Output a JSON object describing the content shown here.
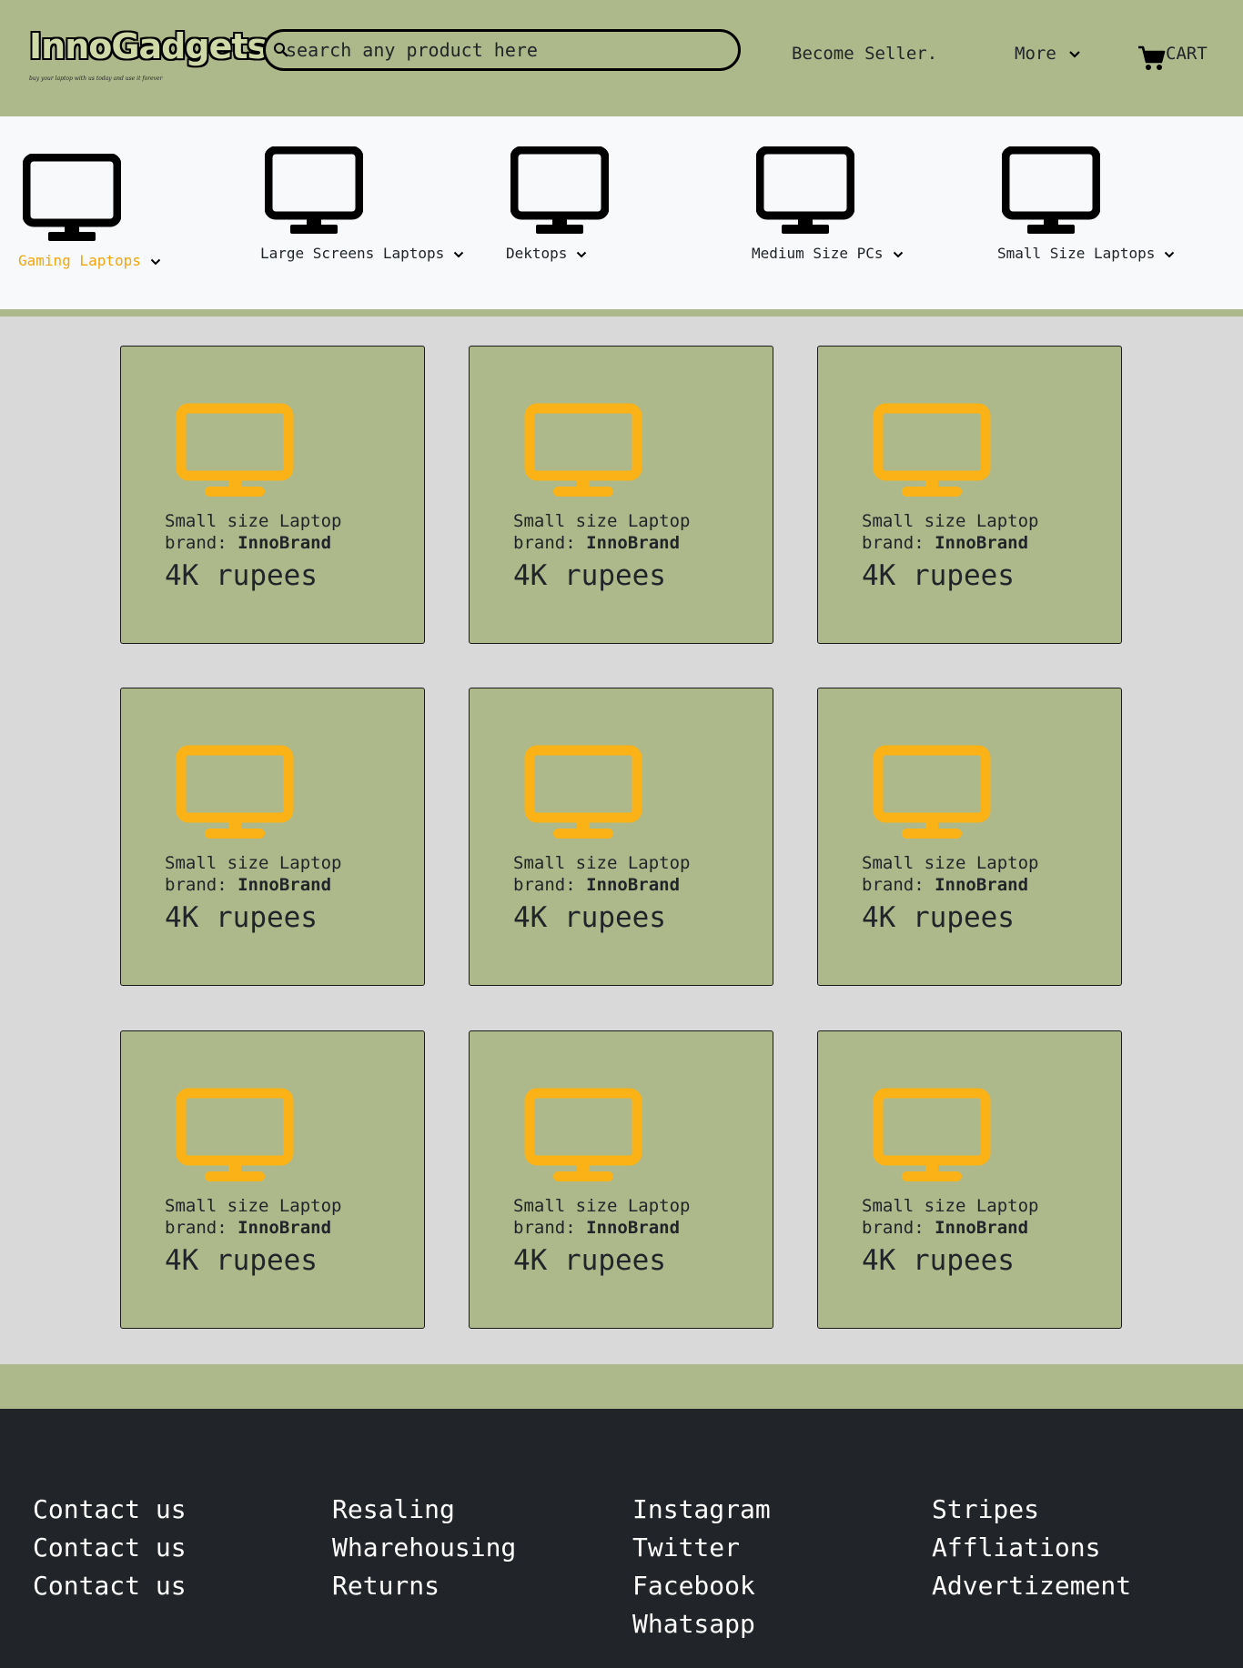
{
  "header": {
    "logo_text": "InnoGadgets",
    "logo_tagline": "buy your laptop with us today and use it forever",
    "search_placeholder": "search any product here",
    "become_seller": "Become Seller.",
    "more": "More",
    "cart": "CART"
  },
  "categories": [
    {
      "label": "Gaming Laptops",
      "active": true
    },
    {
      "label": "Large Screens Laptops",
      "active": false
    },
    {
      "label": "Dektops",
      "active": false
    },
    {
      "label": "Medium Size PCs",
      "active": false
    },
    {
      "label": "Small Size Laptops",
      "active": false
    }
  ],
  "products": [
    {
      "title": "Small size Laptop",
      "brand_label": "brand:",
      "brand": "InnoBrand",
      "price": "4K rupees"
    },
    {
      "title": "Small size Laptop",
      "brand_label": "brand:",
      "brand": "InnoBrand",
      "price": "4K rupees"
    },
    {
      "title": "Small size Laptop",
      "brand_label": "brand:",
      "brand": "InnoBrand",
      "price": "4K rupees"
    },
    {
      "title": "Small size Laptop",
      "brand_label": "brand:",
      "brand": "InnoBrand",
      "price": "4K rupees"
    },
    {
      "title": "Small size Laptop",
      "brand_label": "brand:",
      "brand": "InnoBrand",
      "price": "4K rupees"
    },
    {
      "title": "Small size Laptop",
      "brand_label": "brand:",
      "brand": "InnoBrand",
      "price": "4K rupees"
    },
    {
      "title": "Small size Laptop",
      "brand_label": "brand:",
      "brand": "InnoBrand",
      "price": "4K rupees"
    },
    {
      "title": "Small size Laptop",
      "brand_label": "brand:",
      "brand": "InnoBrand",
      "price": "4K rupees"
    },
    {
      "title": "Small size Laptop",
      "brand_label": "brand:",
      "brand": "InnoBrand",
      "price": "4K rupees"
    }
  ],
  "footer": {
    "columns": [
      [
        "Contact us",
        "Contact us",
        "Contact us"
      ],
      [
        "Resaling",
        "Wharehousing",
        "Returns"
      ],
      [
        "Instagram",
        "Twitter",
        "Facebook",
        "Whatsapp"
      ],
      [
        "Stripes",
        "Affliations",
        "Advertizement"
      ]
    ]
  },
  "icons": {
    "search": "search-icon",
    "caret": "chevron-down-icon",
    "cart": "cart-icon",
    "category": "desktop-monitor-icon",
    "product": "desktop-monitor-icon"
  },
  "colors": {
    "brand_green": "#adb98b",
    "accent_orange": "#f5a50b",
    "monitor_yellow": "#fbb216",
    "footer_dark": "#212529",
    "page_gray": "#d9d9d9",
    "category_bg": "#f8f9fa"
  }
}
